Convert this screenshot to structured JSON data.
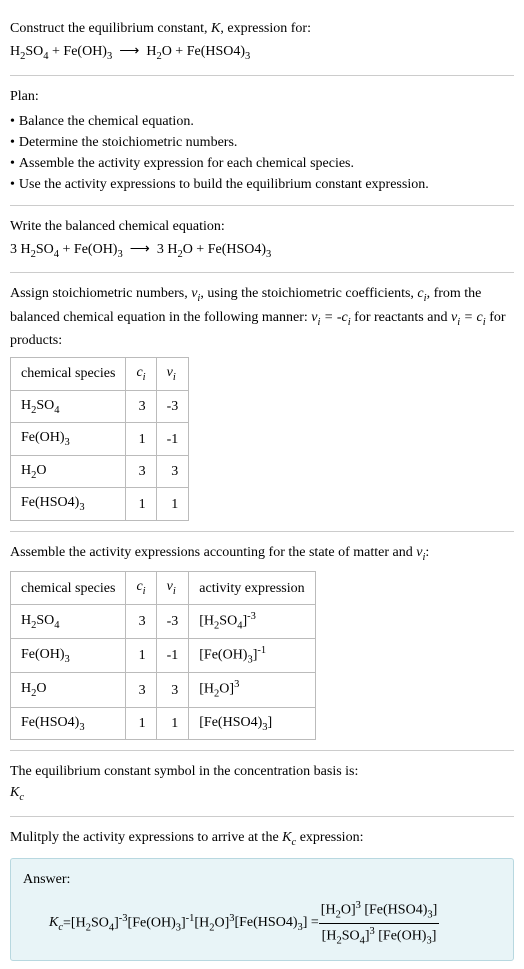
{
  "prompt": {
    "line1_a": "Construct the equilibrium constant, ",
    "line1_b": ", expression for:",
    "equation_lhs1": "H",
    "equation_lhs2": "SO",
    "equation_plus": " + Fe(OH)",
    "equation_rhs1": "H",
    "equation_rhs2": "O + Fe(HSO4)"
  },
  "plan": {
    "heading": "Plan:",
    "items": [
      "Balance the chemical equation.",
      "Determine the stoichiometric numbers.",
      "Assemble the activity expression for each chemical species.",
      "Use the activity expressions to build the equilibrium constant expression."
    ]
  },
  "balanced": {
    "intro": "Write the balanced chemical equation:",
    "coef1": "3 H",
    "mid1": "SO",
    "mid2": " + Fe(OH)",
    "coef2": "3 H",
    "mid3": "O + Fe(HSO4)"
  },
  "stoich": {
    "intro_a": "Assign stoichiometric numbers, ",
    "intro_b": ", using the stoichiometric coefficients, ",
    "intro_c": ", from the balanced chemical equation in the following manner: ",
    "intro_d": " for reactants and ",
    "intro_e": " for products:",
    "h_species": "chemical species",
    "h_ci": "c",
    "h_vi": "ν",
    "rows": [
      {
        "sp_a": "H",
        "sp_b": "SO",
        "ci": "3",
        "vi": "-3"
      },
      {
        "sp_a": "Fe(OH)",
        "ci": "1",
        "vi": "-1"
      },
      {
        "sp_a": "H",
        "sp_b": "O",
        "ci": "3",
        "vi": "3"
      },
      {
        "sp_a": "Fe(HSO4)",
        "ci": "1",
        "vi": "1"
      }
    ]
  },
  "activity": {
    "intro_a": "Assemble the activity expressions accounting for the state of matter and ",
    "intro_b": ":",
    "h_species": "chemical species",
    "h_ci": "c",
    "h_vi": "ν",
    "h_act": "activity expression",
    "rows": [
      {
        "sp_a": "H",
        "sp_b": "SO",
        "ci": "3",
        "vi": "-3",
        "act_a": "[H",
        "act_b": "SO",
        "act_c": "]",
        "exp": "-3"
      },
      {
        "sp_a": "Fe(OH)",
        "ci": "1",
        "vi": "-1",
        "act_a": "[Fe(OH)",
        "act_c": "]",
        "exp": "-1"
      },
      {
        "sp_a": "H",
        "sp_b": "O",
        "ci": "3",
        "vi": "3",
        "act_a": "[H",
        "act_c": "O]",
        "exp": "3"
      },
      {
        "sp_a": "Fe(HSO4)",
        "ci": "1",
        "vi": "1",
        "act_a": "[Fe(HSO4)",
        "act_c": "]"
      }
    ]
  },
  "symbol": {
    "line1": "The equilibrium constant symbol in the concentration basis is:",
    "kc": "K"
  },
  "final": {
    "intro_a": "Mulitply the activity expressions to arrive at the ",
    "intro_b": " expression:",
    "answer_label": "Answer:",
    "kc": "K",
    "eq": " = ",
    "t1_a": "[H",
    "t1_b": "SO",
    "t1_c": "]",
    "t1_exp": "-3",
    "t2_a": " [Fe(OH)",
    "t2_c": "]",
    "t2_exp": "-1",
    "t3_a": " [H",
    "t3_c": "O]",
    "t3_exp": "3",
    "t4_a": " [Fe(HSO4)",
    "t4_c": "] = ",
    "num_a": "[H",
    "num_b": "O]",
    "num_exp": "3",
    "num_c": " [Fe(HSO4)",
    "num_d": "]",
    "den_a": "[H",
    "den_b": "SO",
    "den_c": "]",
    "den_exp": "3",
    "den_d": " [Fe(OH)",
    "den_e": "]"
  }
}
